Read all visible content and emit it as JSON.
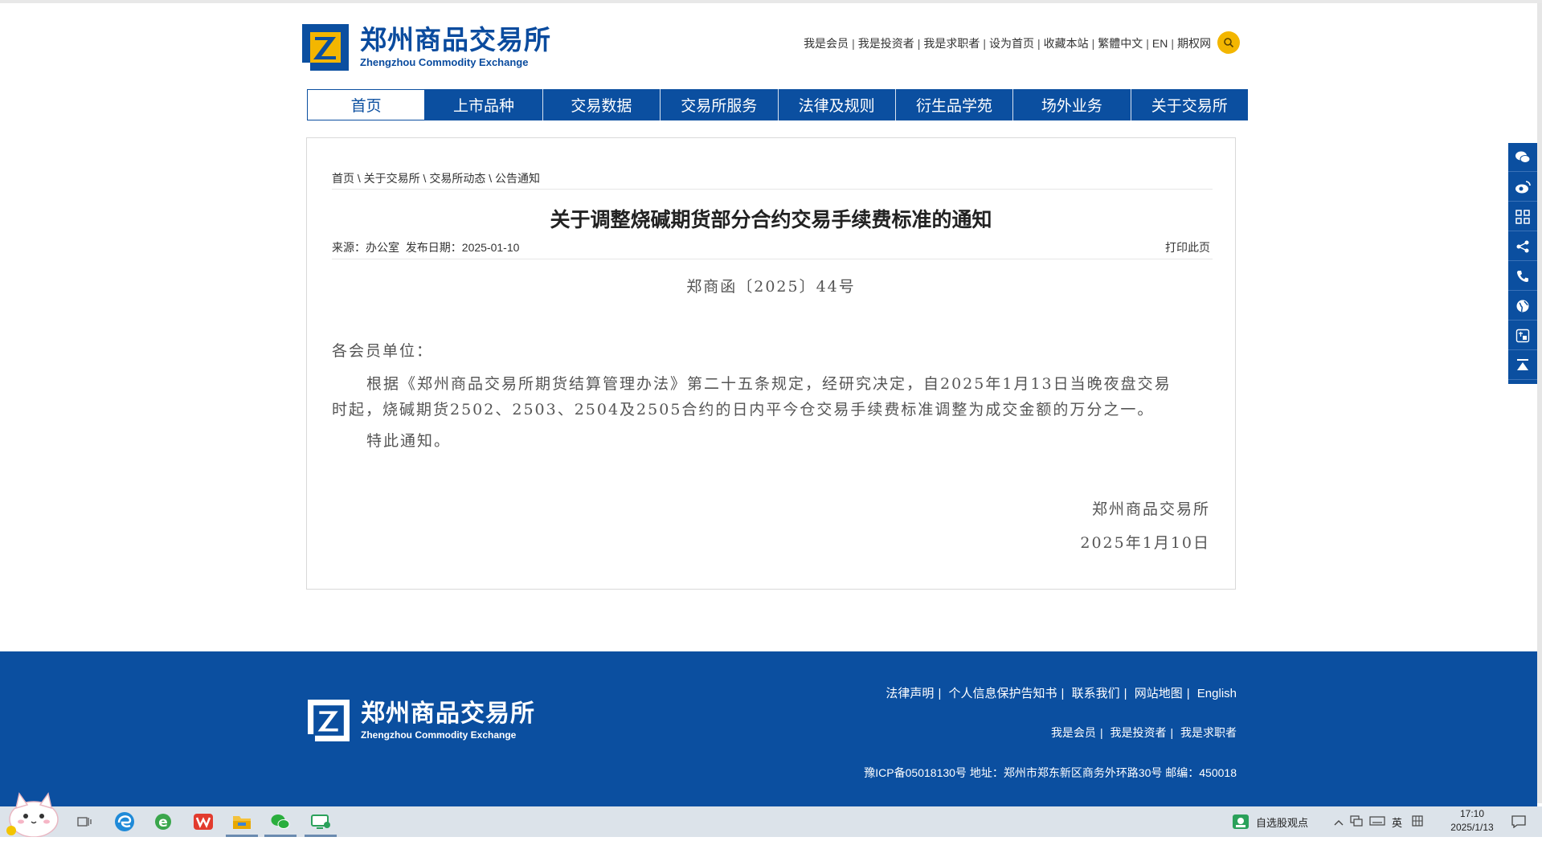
{
  "header": {
    "logo_cn": "郑州商品交易所",
    "logo_en": "Zhengzhou Commodity Exchange",
    "toplinks": [
      "我是会员",
      "我是投资者",
      "我是求职者",
      "设为首页",
      "收藏本站",
      "繁體中文",
      "EN",
      "期权网"
    ]
  },
  "nav": {
    "items": [
      "首页",
      "上市品种",
      "交易数据",
      "交易所服务",
      "法律及规则",
      "衍生品学苑",
      "场外业务",
      "关于交易所"
    ]
  },
  "article": {
    "breadcrumb": [
      "首页",
      "关于交易所",
      "交易所动态",
      "公告通知"
    ],
    "title": "关于调整烧碱期货部分合约交易手续费标准的通知",
    "source_label": "来源：",
    "source": "办公室",
    "date_label": "发布日期：",
    "date": "2025-01-10",
    "print": "打印此页",
    "doc_no": "郑商函〔2025〕44号",
    "salutation": "各会员单位：",
    "paragraph": "根据《郑州商品交易所期货结算管理办法》第二十五条规定，经研究决定，自2025年1月13日当晚夜盘交易时起，烧碱期货2502、2503、2504及2505合约的日内平今仓交易手续费标准调整为成交金额的万分之一。",
    "closing": "特此通知。",
    "signature": "郑州商品交易所",
    "sign_date": "2025年1月10日"
  },
  "sidebar": {
    "icons": [
      "wechat-icon",
      "weibo-icon",
      "app-grid-icon",
      "share-icon",
      "phone-icon",
      "globe-icon",
      "translate-icon",
      "back-to-top-icon"
    ]
  },
  "footer": {
    "logo_cn": "郑州商品交易所",
    "logo_en": "Zhengzhou Commodity Exchange",
    "links1": [
      "法律声明",
      "个人信息保护告知书",
      "联系我们",
      "网站地图",
      "English"
    ],
    "links2": [
      "我是会员",
      "我是投资者",
      "我是求职者"
    ],
    "icp": "豫ICP备05018130号 地址：郑州市郑东新区商务外环路30号 邮编：450018"
  },
  "taskbar": {
    "tray_app": "自选股观点",
    "ime": "英",
    "time": "17:10",
    "date": "2025/1/13"
  },
  "colors": {
    "brand_blue": "#0b4fa0",
    "search_yellow": "#f3b600"
  }
}
